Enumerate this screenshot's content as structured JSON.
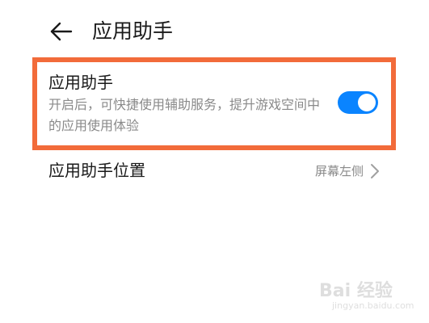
{
  "header": {
    "title": "应用助手",
    "back_icon": "arrow-left-icon"
  },
  "assistant_toggle_row": {
    "title": "应用助手",
    "description": "开启后，可快捷使用辅助服务，提升游戏空间中的应用使用体验",
    "enabled": true,
    "toggle_color": "#0a84ff",
    "highlight_color": "#f26b3a"
  },
  "position_row": {
    "title": "应用助手位置",
    "value": "屏幕左侧",
    "icon": "chevron-right-icon"
  },
  "watermark": {
    "brand": "Bai 经验",
    "url": "jingyan.baidu.com"
  }
}
